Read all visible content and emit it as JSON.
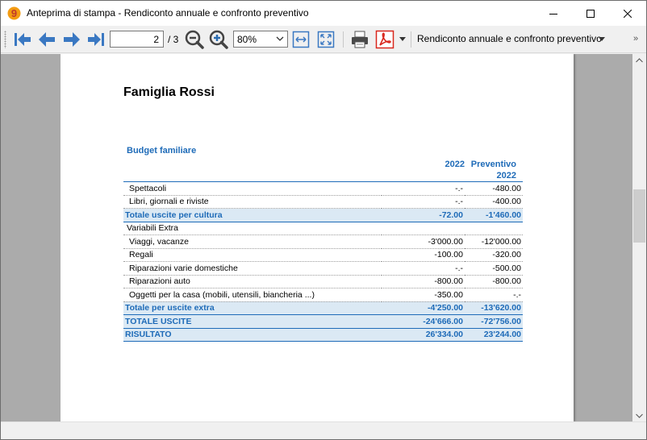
{
  "window": {
    "title": "Anteprima di stampa - Rendiconto annuale e confronto preventivo"
  },
  "toolbar": {
    "page_current": "2",
    "page_total": "/ 3",
    "zoom_value": "80%",
    "report_select": "Rendiconto annuale e confronto preventivo",
    "overflow": "»"
  },
  "report": {
    "family": "Famiglia Rossi",
    "subtitle": "Budget familiare",
    "col_year": "2022",
    "col_budget_line1": "Preventivo",
    "col_budget_line2": "2022",
    "rows": [
      {
        "desc": "Spettacoli",
        "v2022": "-.-",
        "prev": "-480.00"
      },
      {
        "desc": "Libri, giornali e riviste",
        "v2022": "-.-",
        "prev": "-400.00"
      },
      {
        "desc": "Totale uscite per cultura",
        "v2022": "-72.00",
        "prev": "-1'460.00"
      },
      {
        "desc": "Variabili Extra",
        "v2022": "",
        "prev": ""
      },
      {
        "desc": "Viaggi, vacanze",
        "v2022": "-3'000.00",
        "prev": "-12'000.00"
      },
      {
        "desc": "Regali",
        "v2022": "-100.00",
        "prev": "-320.00"
      },
      {
        "desc": "Riparazioni varie domestiche",
        "v2022": "-.-",
        "prev": "-500.00"
      },
      {
        "desc": "Riparazioni auto",
        "v2022": "-800.00",
        "prev": "-800.00"
      },
      {
        "desc": "Oggetti per la casa (mobili, utensili, biancheria ...)",
        "v2022": "-350.00",
        "prev": "-.-"
      },
      {
        "desc": "Totale per uscite extra",
        "v2022": "-4'250.00",
        "prev": "-13'620.00"
      },
      {
        "desc": "TOTALE USCITE",
        "v2022": "-24'666.00",
        "prev": "-72'756.00"
      },
      {
        "desc": "RISULTATO",
        "v2022": "26'334.00",
        "prev": "23'244.00"
      }
    ]
  },
  "colors": {
    "accent_blue": "#1e6bb8",
    "total_row_bg": "#dbe9f4",
    "icon_blue": "#3a78c2",
    "pdf_red": "#d9261c"
  },
  "icons": {
    "app": "app-logo-icon",
    "first": "first-page-icon",
    "prev": "previous-page-icon",
    "next": "next-page-icon",
    "last": "last-page-icon",
    "zoom_out": "zoom-out-icon",
    "zoom_in": "zoom-in-icon",
    "fit_width": "fit-width-icon",
    "fit_page": "fit-page-icon",
    "print": "printer-icon",
    "pdf": "pdf-icon"
  }
}
